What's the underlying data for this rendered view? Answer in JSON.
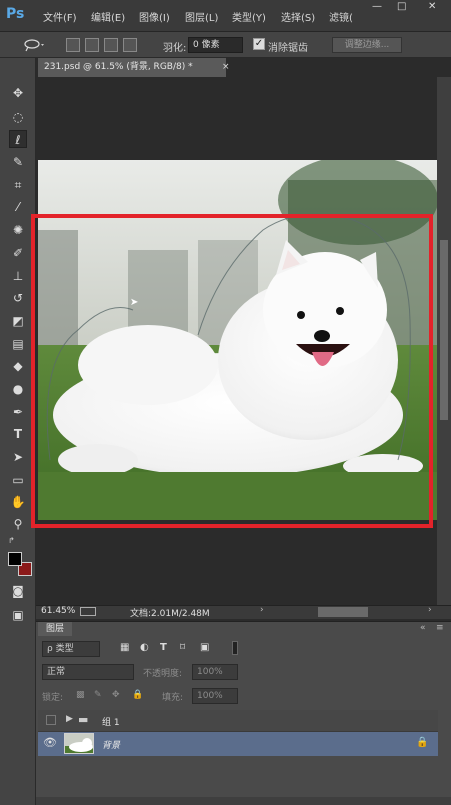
{
  "app": {
    "logo": "Ps"
  },
  "menu": {
    "file": "文件(F)",
    "edit": "编辑(E)",
    "image": "图像(I)",
    "layer": "图层(L)",
    "type": "类型(Y)",
    "select": "选择(S)",
    "filter": "滤镜("
  },
  "window_controls": {
    "minimize": "—",
    "maximize": "□",
    "close": "✕"
  },
  "options": {
    "feather_label": "羽化:",
    "feather_value": "0 像素",
    "antialias_checked": true,
    "antialias_label": "消除锯齿",
    "refine_edge": "调整边缘..."
  },
  "document": {
    "tab_title": "231.psd @ 61.5% (背景, RGB/8) *",
    "tab_close": "×"
  },
  "status": {
    "zoom": "61.45%",
    "doc_info": "文档:2.01M/2.48M"
  },
  "layers_panel": {
    "tab": "图层",
    "close": "«",
    "menu": "≡",
    "filter_kind": "ρ 类型",
    "blend_mode": "正常",
    "opacity_label": "不透明度:",
    "opacity_value": "100%",
    "lock_label": "锁定:",
    "fill_label": "填充:",
    "fill_value": "100%",
    "layers": [
      {
        "name": "组 1",
        "type": "group",
        "visible": false
      },
      {
        "name": "背景",
        "type": "background",
        "visible": true,
        "selected": true,
        "locked": true
      }
    ]
  },
  "colors": {
    "accent_selection": "#e3232a",
    "selected_layer": "#5b6d8c",
    "foreground": "#000000",
    "background": "#8b1a1a"
  }
}
